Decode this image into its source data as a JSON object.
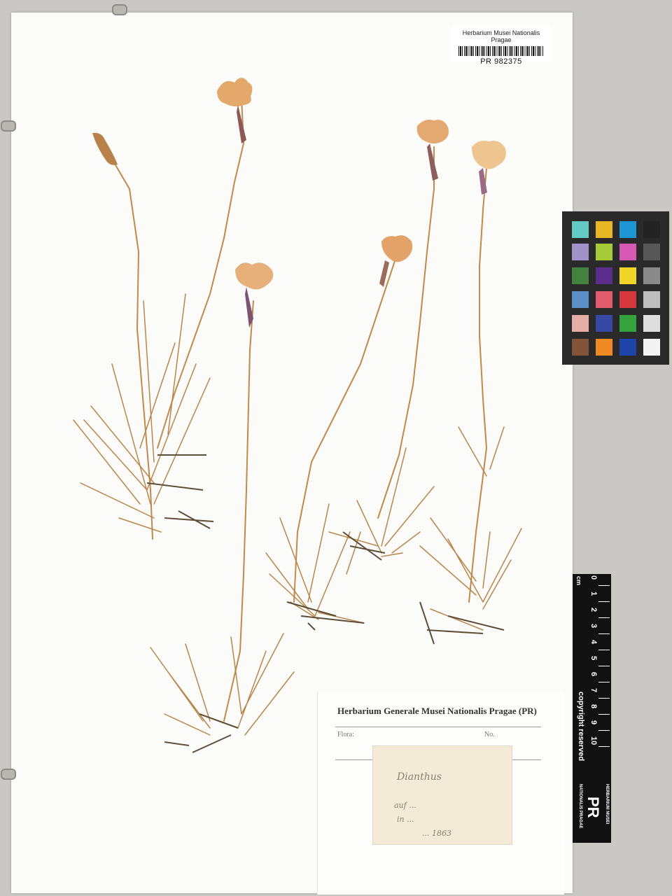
{
  "barcode_label": {
    "title": "Herbarium Musei Nationalis Pragae",
    "id": "PR 982375"
  },
  "main_label": {
    "title": "Herbarium Generale Musei Nationalis Pragae (PR)",
    "flora_label": "Flora:",
    "no_label": "No."
  },
  "handwritten_label": {
    "line1": "Dianthus",
    "line2": "auf ...",
    "line3": "in ...",
    "line4": "... 1863"
  },
  "scale_bar": {
    "unit": "cm",
    "numbers": [
      "0",
      "1",
      "2",
      "3",
      "4",
      "5",
      "6",
      "7",
      "8",
      "9",
      "10"
    ],
    "copyright": "copyright reserved",
    "logo": "PR",
    "institution_top": "HERBARIUM MUSEI",
    "institution_bottom": "NATIONALIS PRAGAE"
  },
  "color_card": {
    "patches": [
      "#63cbc3",
      "#e9b626",
      "#1e96d3",
      "#232323",
      "#a093c8",
      "#a5cc37",
      "#d65ab5",
      "#575757",
      "#43813e",
      "#5a2f8b",
      "#f2d627",
      "#8a8a8a",
      "#5b8fc7",
      "#e15b6d",
      "#d4373c",
      "#bdbdbd",
      "#e6aca6",
      "#3748a5",
      "#35a33d",
      "#dedede",
      "#83533a",
      "#ef8a23",
      "#1c45a7",
      "#f3f3f3"
    ]
  }
}
